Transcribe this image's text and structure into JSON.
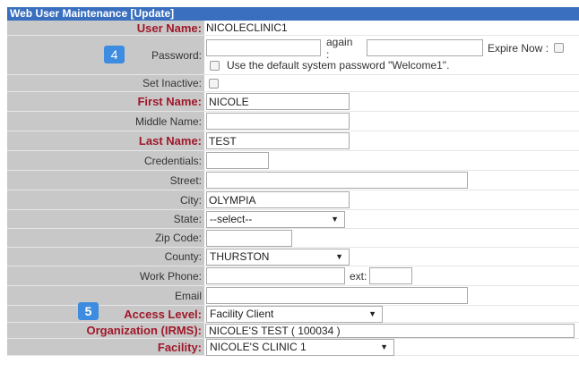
{
  "title": "Web User Maintenance [Update]",
  "labels": {
    "user_name": "User Name:",
    "password": "Password:",
    "again": "again :",
    "expire_now": "Expire Now :",
    "default_pw": "Use the default system password \"Welcome1\".",
    "set_inactive": "Set Inactive:",
    "first_name": "First Name:",
    "middle_name": "Middle Name:",
    "last_name": "Last Name:",
    "credentials": "Credentials:",
    "street": "Street:",
    "city": "City:",
    "state": "State:",
    "zip": "Zip Code:",
    "county": "County:",
    "work_phone": "Work Phone:",
    "ext": "ext:",
    "email": "Email",
    "access_level": "Access Level:",
    "organization": "Organization (IRMS):",
    "facility": "Facility:"
  },
  "values": {
    "user_name": "NICOLECLINIC1",
    "password": "",
    "password_again": "",
    "first_name": "NICOLE",
    "middle_name": "",
    "last_name": "TEST",
    "credentials": "",
    "street": "",
    "city": "OLYMPIA",
    "state": "--select--",
    "zip": "",
    "county": "THURSTON",
    "work_phone": "",
    "ext": "",
    "email": "",
    "access_level": "Facility Client",
    "organization": "NICOLE'S TEST ( 100034 )",
    "facility": "NICOLE'S CLINIC 1"
  },
  "badges": {
    "password_step": "4",
    "access_step": "5"
  },
  "icons": {
    "dropdown": "dropdown-arrow-icon",
    "checkbox": "checkbox-icon"
  },
  "colors": {
    "title_bar": "#3a6fbf",
    "required_label": "#a0182a",
    "badge": "#3d8ce0",
    "label_bg": "#c8c8c8"
  }
}
